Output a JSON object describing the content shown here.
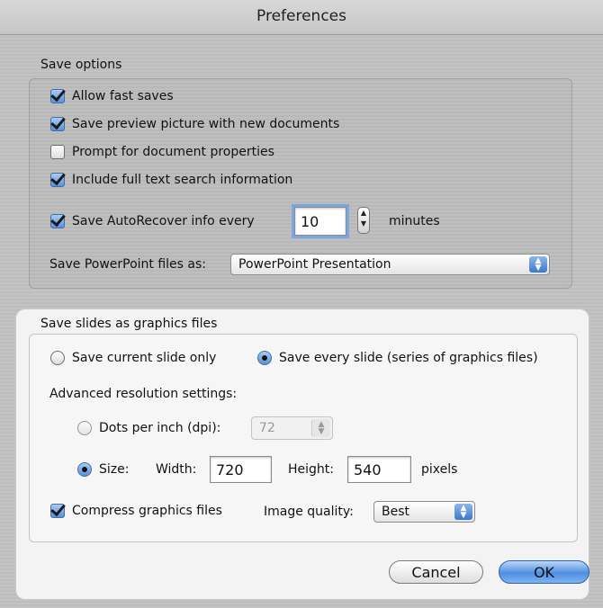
{
  "window": {
    "title": "Preferences"
  },
  "save_options": {
    "label": "Save options",
    "allow_fast_saves": {
      "label": "Allow fast saves",
      "checked": true
    },
    "save_preview": {
      "label": "Save preview picture with new documents",
      "checked": true
    },
    "prompt_properties": {
      "label": "Prompt for document properties",
      "checked": false
    },
    "full_text_search": {
      "label": "Include full text search information",
      "checked": true
    },
    "autorecover": {
      "label": "Save AutoRecover info every",
      "checked": true,
      "value": "10",
      "unit": "minutes"
    },
    "save_as": {
      "label": "Save PowerPoint files as:",
      "selected": "PowerPoint Presentation"
    }
  },
  "graphics": {
    "label": "Save slides as graphics files",
    "current_slide_label": "Save current slide only",
    "every_slide_label": "Save every slide (series of graphics files)",
    "every_slide_selected": true,
    "advanced_label": "Advanced resolution settings:",
    "dpi_label": "Dots per inch (dpi):",
    "dpi_value": "72",
    "size_label": "Size:",
    "width_label": "Width:",
    "width_value": "720",
    "height_label": "Height:",
    "height_value": "540",
    "pixels_label": "pixels",
    "compress_label": "Compress graphics files",
    "compress_checked": true,
    "quality_label": "Image quality:",
    "quality_value": "Best"
  },
  "buttons": {
    "cancel": "Cancel",
    "ok": "OK"
  },
  "colors": {
    "accent": "#5b8fd6",
    "panel": "#f3f3f3"
  }
}
